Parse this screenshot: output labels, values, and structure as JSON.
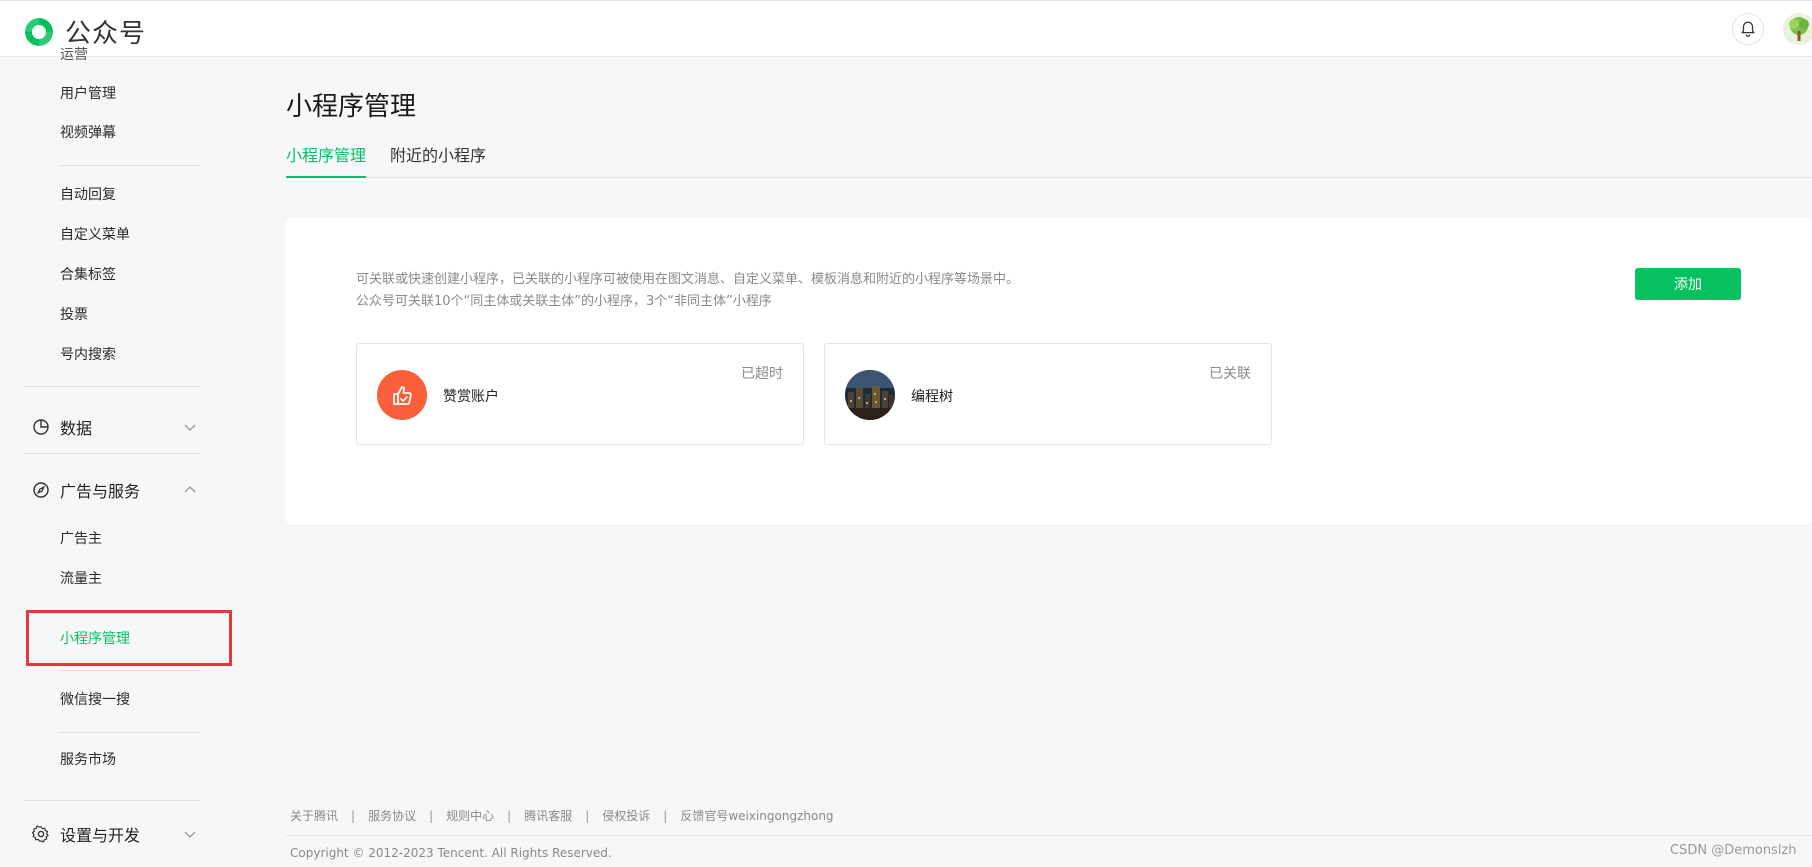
{
  "app": {
    "name": "公众号"
  },
  "sidebar": {
    "partial_top_label": "运营",
    "items": [
      "用户管理",
      "视频弹幕",
      "自动回复",
      "自定义菜单",
      "合集标签",
      "投票",
      "号内搜索"
    ],
    "sections": [
      {
        "label": "数据",
        "icon": "pie-chart-icon",
        "expanded": false
      },
      {
        "label": "广告与服务",
        "icon": "compass-icon",
        "expanded": true
      },
      {
        "label": "设置与开发",
        "icon": "gear-icon",
        "expanded": false
      }
    ],
    "service_items": [
      "广告主",
      "流量主",
      "小程序管理",
      "微信搜一搜",
      "服务市场"
    ]
  },
  "main": {
    "title": "小程序管理",
    "tabs": [
      {
        "label": "小程序管理",
        "active": true
      },
      {
        "label": "附近的小程序",
        "active": false
      }
    ],
    "description": [
      "可关联或快速创建小程序，已关联的小程序可被使用在图文消息、自定义菜单、模板消息和附近的小程序等场景中。",
      "公众号可关联10个“同主体或关联主体”的小程序，3个“非同主体”小程序"
    ],
    "add_button": "添加",
    "mini_programs": [
      {
        "name": "赞赏账户",
        "status": "已超时",
        "icon": "thumbs-up-icon"
      },
      {
        "name": "编程树",
        "status": "已关联",
        "icon": "city-night-avatar"
      }
    ]
  },
  "footer": {
    "links": [
      "关于腾讯",
      "服务协议",
      "规则中心",
      "腾讯客服",
      "侵权投诉",
      "反馈官号weixingongzhong"
    ],
    "copyright": "Copyright © 2012-2023 Tencent. All Rights Reserved.",
    "watermark": "CSDN @Demonslzh"
  },
  "colors": {
    "brand": "#07c160",
    "highlight": "#e8343a",
    "icon_orange": "#fa5f3c"
  }
}
